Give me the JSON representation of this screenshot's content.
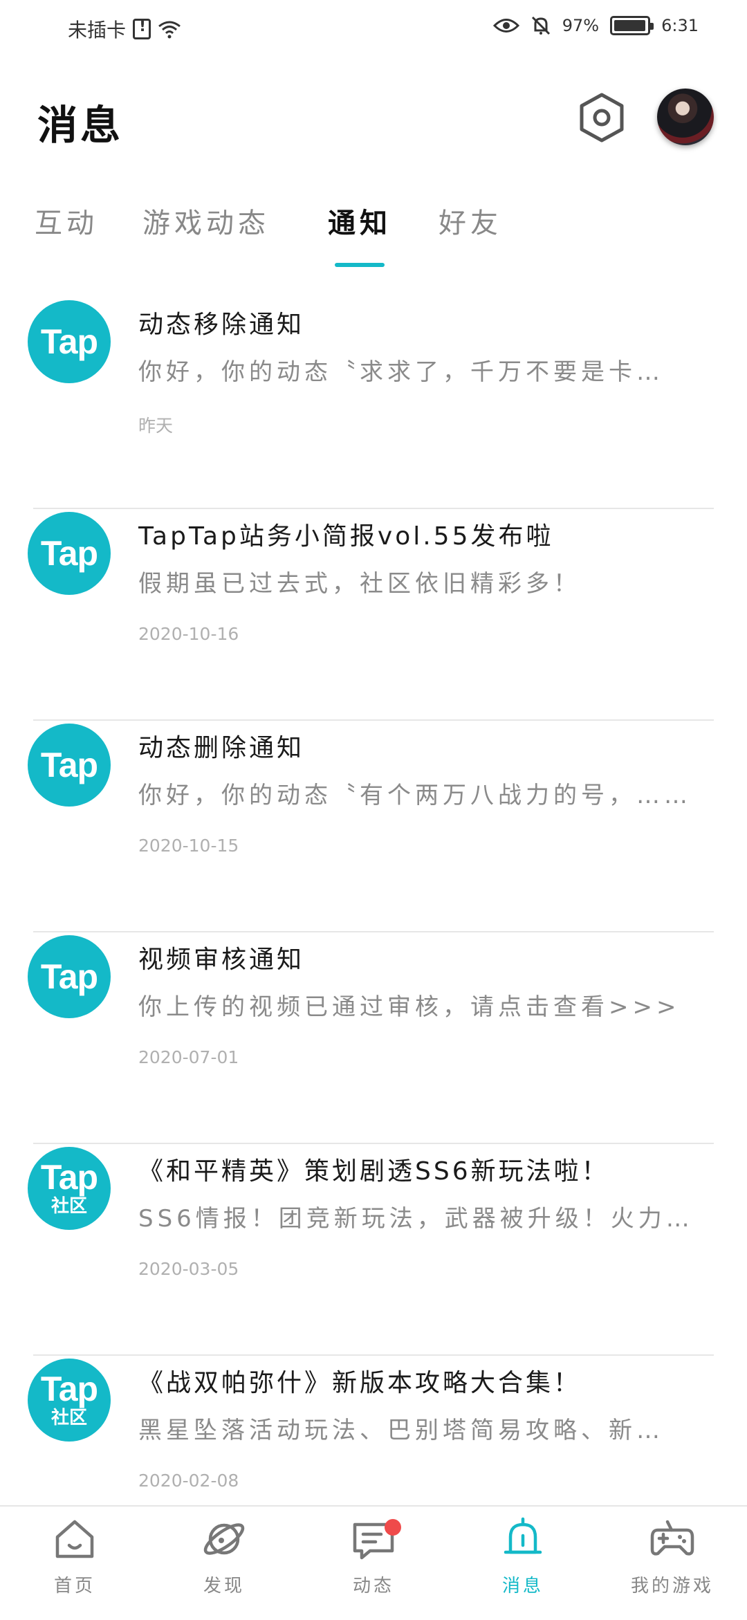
{
  "status_bar": {
    "carrier": "未插卡",
    "battery": "97%",
    "battery_level": 0.97,
    "time": "6:31",
    "icons": [
      "sim-alert-icon",
      "wifi-icon",
      "eye-icon",
      "bell-mute-icon",
      "battery-icon"
    ]
  },
  "header": {
    "title": "消息",
    "settings_icon": "settings-hexagon-icon"
  },
  "tabs": [
    {
      "label": "互动",
      "active": false
    },
    {
      "label": "游戏动态",
      "active": false
    },
    {
      "label": "通知",
      "active": true
    },
    {
      "label": "好友",
      "active": false
    }
  ],
  "accent_color": "#14b9c8",
  "notifications": [
    {
      "logo_text": "Tap",
      "logo_sub": "",
      "title": "动态移除通知",
      "desc": "你好，你的动态〝求求了，千万不要是卡…",
      "date": "昨天"
    },
    {
      "logo_text": "Tap",
      "logo_sub": "",
      "title": "TapTap站务小简报vol.55发布啦",
      "desc": "假期虽已过去式，社区依旧精彩多！",
      "date": "2020-10-16"
    },
    {
      "logo_text": "Tap",
      "logo_sub": "",
      "title": "动态删除通知",
      "desc": "你好，你的动态〝有个两万八战力的号，……",
      "date": "2020-10-15"
    },
    {
      "logo_text": "Tap",
      "logo_sub": "",
      "title": "视频审核通知",
      "desc": "你上传的视频已通过审核，请点击查看>>>",
      "date": "2020-07-01"
    },
    {
      "logo_text": "Tap",
      "logo_sub": "社区",
      "title": "《和平精英》策划剧透SS6新玩法啦！",
      "desc": "SS6情报！团竞新玩法，武器被升级！火力…",
      "date": "2020-03-05"
    },
    {
      "logo_text": "Tap",
      "logo_sub": "社区",
      "title": "《战双帕弥什》新版本攻略大合集！",
      "desc": "黑星坠落活动玩法、巴别塔简易攻略、新…",
      "date": "2020-02-08"
    }
  ],
  "bottom_nav": [
    {
      "label": "首页",
      "icon": "home-icon",
      "active": false
    },
    {
      "label": "发现",
      "icon": "discover-planet-icon",
      "active": false
    },
    {
      "label": "动态",
      "icon": "feed-chat-icon",
      "active": false,
      "badge": true
    },
    {
      "label": "消息",
      "icon": "bell-icon",
      "active": true
    },
    {
      "label": "我的游戏",
      "icon": "gamepad-icon",
      "active": false
    }
  ]
}
